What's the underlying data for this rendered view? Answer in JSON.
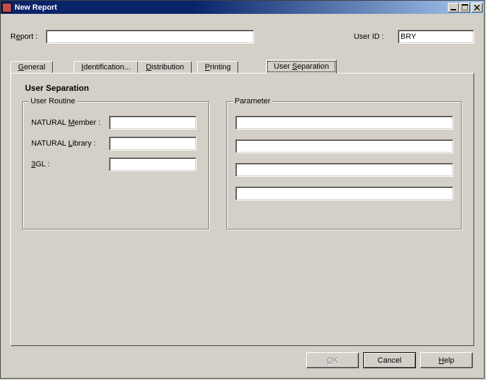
{
  "window": {
    "title": "New Report"
  },
  "top": {
    "report_label_pre": "R",
    "report_label_u": "e",
    "report_label_post": "port :",
    "report_value": "",
    "userid_label": "User ID :",
    "userid_value": "BRY"
  },
  "tabs": {
    "general_u": "G",
    "general_post": "eneral",
    "identification_u": "I",
    "identification_post": "dentification...",
    "distribution_u": "D",
    "distribution_post": "istribution",
    "printing_u": "P",
    "printing_post": "rinting",
    "usersep_pre": "User ",
    "usersep_u": "S",
    "usersep_post": "eparation"
  },
  "panel": {
    "title": "User Separation",
    "group_routine": "User Routine",
    "group_parameter": "Parameter",
    "natural_member_pre": "NATURAL ",
    "natural_member_u": "M",
    "natural_member_post": "ember :",
    "natural_member_value": "",
    "natural_library_pre": "NATURAL ",
    "natural_library_u": "L",
    "natural_library_post": "ibrary :",
    "natural_library_value": "",
    "threegl_u": "3",
    "threegl_post": "GL :",
    "threegl_value": "",
    "param1": "",
    "param2": "",
    "param3": "",
    "param4": ""
  },
  "buttons": {
    "ok_u": "O",
    "ok_post": "K",
    "cancel": "Cancel",
    "help_u": "H",
    "help_post": "elp"
  }
}
